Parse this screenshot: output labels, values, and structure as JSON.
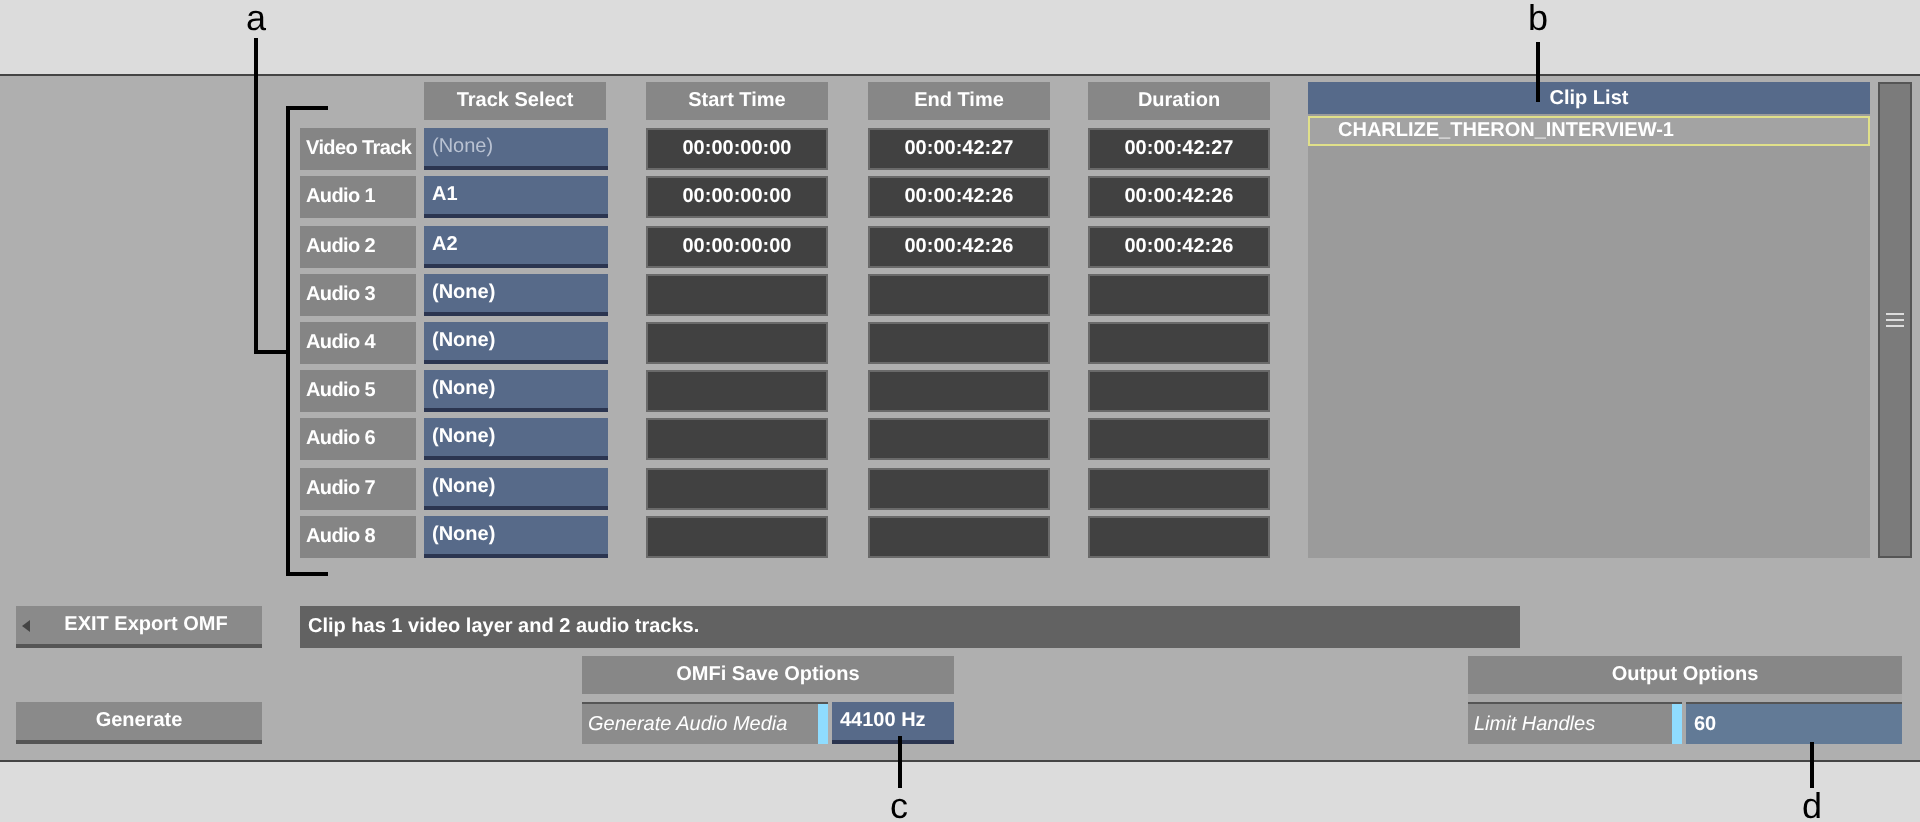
{
  "columns": [
    "Track Select",
    "Start Time",
    "End Time",
    "Duration"
  ],
  "tracks": [
    {
      "label": "Video Track",
      "source": "(None)",
      "assigned": false,
      "start": "00:00:00:00",
      "end": "00:00:42:27",
      "duration": "00:00:42:27"
    },
    {
      "label": "Audio 1",
      "source": "A1",
      "assigned": true,
      "start": "00:00:00:00",
      "end": "00:00:42:26",
      "duration": "00:00:42:26"
    },
    {
      "label": "Audio 2",
      "source": "A2",
      "assigned": true,
      "start": "00:00:00:00",
      "end": "00:00:42:26",
      "duration": "00:00:42:26"
    },
    {
      "label": "Audio 3",
      "source": "(None)",
      "assigned": true
    },
    {
      "label": "Audio 4",
      "source": "(None)",
      "assigned": true
    },
    {
      "label": "Audio 5",
      "source": "(None)",
      "assigned": true
    },
    {
      "label": "Audio 6",
      "source": "(None)",
      "assigned": true
    },
    {
      "label": "Audio 7",
      "source": "(None)",
      "assigned": true
    },
    {
      "label": "Audio 8",
      "source": "(None)",
      "assigned": true
    }
  ],
  "clip_list": {
    "title": "Clip List",
    "items": [
      {
        "name": "CHARLIZE_THERON_INTERVIEW-1",
        "selected": true
      }
    ]
  },
  "exit_button": "EXIT Export OMF",
  "status": "Clip has 1 video layer and 2 audio tracks.",
  "generate_button": "Generate",
  "omfi_save_options": {
    "title": "OMFi Save Options",
    "toggle": {
      "label": "Generate Audio Media",
      "on": true
    },
    "value": "44100 Hz"
  },
  "output_options": {
    "title": "Output Options",
    "toggle": {
      "label": "Limit Handles",
      "on": true
    },
    "value": "60"
  },
  "callouts": [
    {
      "label": "a"
    },
    {
      "label": "b"
    },
    {
      "label": "c"
    },
    {
      "label": "d"
    }
  ]
}
